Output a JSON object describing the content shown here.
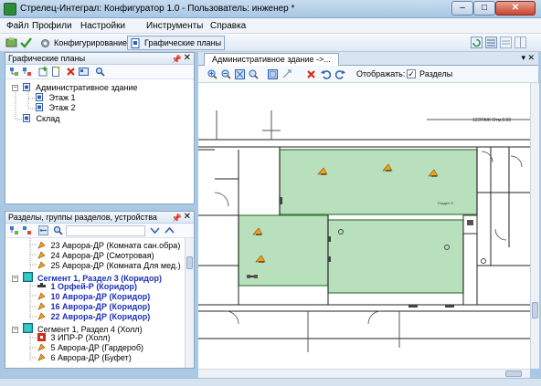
{
  "window": {
    "title": "Стрелец-Интеграл: Конфигуратор 1.0 - Пользователь: инженер *",
    "min_glyph": "–",
    "max_glyph": "□",
    "close_glyph": "✕"
  },
  "menu": {
    "items": [
      "Файл",
      "Профили",
      "Настройки",
      "Инструменты",
      "Справка"
    ]
  },
  "toolbar": {
    "configure_label": "Конфигурирование",
    "plans_label": "Графические планы"
  },
  "plans_pane": {
    "title": "Графические планы",
    "pin_glyph": "📌",
    "close_glyph": "✕",
    "tree": {
      "building": "Административное здание",
      "floor1": "Этаж 1",
      "floor2": "Этаж 2",
      "warehouse": "Склад",
      "collapse_glyph": "−",
      "expand_glyph": "+"
    }
  },
  "sections_pane": {
    "title": "Разделы, группы разделов, устройства",
    "pin_glyph": "📌",
    "close_glyph": "✕",
    "rows": [
      "23 Аврора-ДР (Комната сан.обра)",
      "24 Аврора-ДР (Смотровая)",
      "25 Аврора-ДР (Комната Для мед.)",
      "Сегмент 1, Раздел 3 (Коридор)",
      "1 Орфей-Р (Коридор)",
      "10 Аврора-ДР (Коридор)",
      "16 Аврора-ДР (Коридор)",
      "22 Аврора-ДР (Коридор)",
      "Сегмент 1, Раздел 4 (Холл)",
      "3 ИПР-Р (Холл)",
      "5 Аврора-ДР (Гардероб)",
      "6 Аврора-ДР (Буфет)"
    ]
  },
  "document": {
    "tab_title": "Административное здание ->...",
    "display_label": "Отображать:",
    "sections_checkbox": "Разделы",
    "sections_checked": true,
    "close_glyph": "✕",
    "plan_labels": {
      "top_right": "13ЭТАЖ Отм.0.00",
      "room_note": "Раздел 3"
    }
  },
  "colors": {
    "zone_fill": "#b9e0bd",
    "zone_stroke": "#3a7a3e",
    "selected_text": "#1b2fb8",
    "section_icon": "#37c8c8"
  }
}
